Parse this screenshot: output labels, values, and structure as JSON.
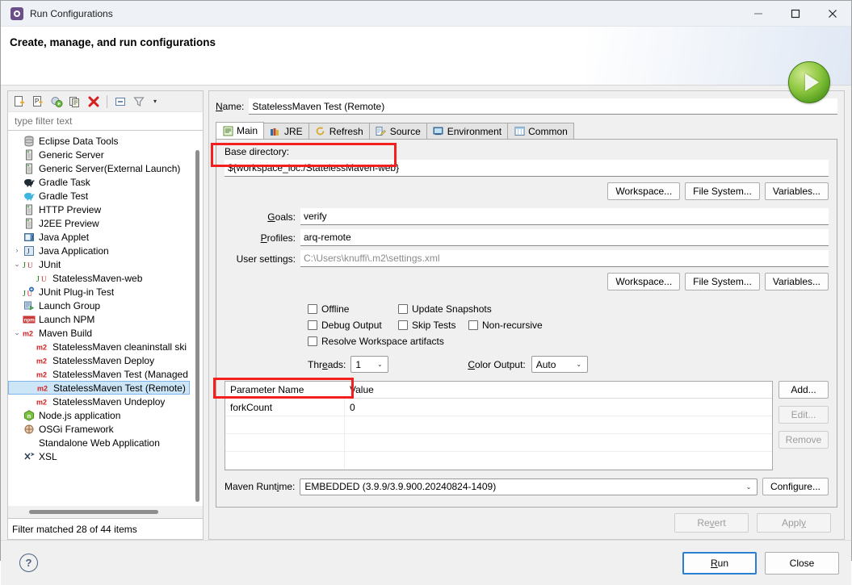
{
  "window": {
    "title": "Run Configurations",
    "app_icon": "eclipse-run-icon",
    "minimize": "–",
    "maximize": "□",
    "close": "✕"
  },
  "header": {
    "title": "Create, manage, and run configurations",
    "banner_icon": "green-run-globe-icon"
  },
  "tree_toolbar": {
    "buttons": [
      {
        "name": "new-configuration-icon",
        "tip": "New launch configuration"
      },
      {
        "name": "new-prototype-icon",
        "tip": "New prototype"
      },
      {
        "name": "export-icon",
        "tip": "Export"
      },
      {
        "name": "duplicate-icon",
        "tip": "Duplicate"
      },
      {
        "name": "delete-icon",
        "tip": "Delete"
      },
      {
        "name": "collapse-all-icon",
        "tip": "Collapse All"
      },
      {
        "name": "filter-icon",
        "tip": "Filter launch configurations"
      }
    ],
    "menu_caret": "▾"
  },
  "filter": {
    "placeholder": "type filter text",
    "value": "",
    "status": "Filter matched 28 of 44 items"
  },
  "tree": {
    "items": [
      {
        "label": "Eclipse Data Tools",
        "icon": "database-icon",
        "indent": 1,
        "twisty": "",
        "selected": false
      },
      {
        "label": "Generic Server",
        "icon": "server-icon",
        "indent": 1,
        "twisty": "",
        "selected": false
      },
      {
        "label": "Generic Server(External Launch)",
        "icon": "server-icon",
        "indent": 1,
        "twisty": "",
        "selected": false
      },
      {
        "label": "Gradle Task",
        "icon": "gradle-elephant-dark-icon",
        "indent": 1,
        "twisty": "",
        "selected": false
      },
      {
        "label": "Gradle Test",
        "icon": "gradle-elephant-blue-icon",
        "indent": 1,
        "twisty": "",
        "selected": false
      },
      {
        "label": "HTTP Preview",
        "icon": "server-icon",
        "indent": 1,
        "twisty": "",
        "selected": false
      },
      {
        "label": "J2EE Preview",
        "icon": "server-icon",
        "indent": 1,
        "twisty": "",
        "selected": false
      },
      {
        "label": "Java Applet",
        "icon": "java-applet-icon",
        "indent": 1,
        "twisty": "",
        "selected": false
      },
      {
        "label": "Java Application",
        "icon": "java-application-icon",
        "indent": 1,
        "twisty": "›",
        "selected": false
      },
      {
        "label": "JUnit",
        "icon": "junit-icon",
        "indent": 1,
        "twisty": "⌄",
        "selected": false
      },
      {
        "label": "StatelessMaven-web",
        "icon": "junit-icon",
        "indent": 2,
        "twisty": "",
        "selected": false
      },
      {
        "label": "JUnit Plug-in Test",
        "icon": "junit-plugin-icon",
        "indent": 1,
        "twisty": "",
        "selected": false
      },
      {
        "label": "Launch Group",
        "icon": "launch-group-icon",
        "indent": 1,
        "twisty": "",
        "selected": false
      },
      {
        "label": "Launch NPM",
        "icon": "npm-icon",
        "indent": 1,
        "twisty": "",
        "selected": false
      },
      {
        "label": "Maven Build",
        "icon": "maven-icon",
        "indent": 1,
        "twisty": "⌄",
        "selected": false
      },
      {
        "label": "StatelessMaven cleaninstall ski",
        "icon": "maven-icon",
        "indent": 2,
        "twisty": "",
        "selected": false
      },
      {
        "label": "StatelessMaven Deploy",
        "icon": "maven-icon",
        "indent": 2,
        "twisty": "",
        "selected": false
      },
      {
        "label": "StatelessMaven Test (Managed",
        "icon": "maven-icon",
        "indent": 2,
        "twisty": "",
        "selected": false
      },
      {
        "label": "StatelessMaven Test (Remote)",
        "icon": "maven-icon",
        "indent": 2,
        "twisty": "",
        "selected": true
      },
      {
        "label": "StatelessMaven Undeploy",
        "icon": "maven-icon",
        "indent": 2,
        "twisty": "",
        "selected": false
      },
      {
        "label": "Node.js application",
        "icon": "nodejs-icon",
        "indent": 1,
        "twisty": "",
        "selected": false
      },
      {
        "label": "OSGi Framework",
        "icon": "osgi-icon",
        "indent": 1,
        "twisty": "",
        "selected": false
      },
      {
        "label": "Standalone Web Application",
        "icon": "",
        "indent": 1,
        "twisty": "",
        "selected": false
      },
      {
        "label": "XSL",
        "icon": "xsl-icon",
        "indent": 1,
        "twisty": "",
        "selected": false
      }
    ]
  },
  "config": {
    "name_label": "Name:",
    "name_value": "StatelessMaven Test (Remote)",
    "tabs": [
      {
        "label": "Main",
        "icon": "main-tab-icon",
        "active": true
      },
      {
        "label": "JRE",
        "icon": "jre-tab-icon",
        "active": false
      },
      {
        "label": "Refresh",
        "icon": "refresh-tab-icon",
        "active": false
      },
      {
        "label": "Source",
        "icon": "source-tab-icon",
        "active": false
      },
      {
        "label": "Environment",
        "icon": "environment-tab-icon",
        "active": false
      },
      {
        "label": "Common",
        "icon": "common-tab-icon",
        "active": false
      }
    ],
    "base_directory_label": "Base directory:",
    "base_directory_value": "${workspace_loc:/StatelessMaven-web}",
    "dir_buttons": [
      "Workspace...",
      "File System...",
      "Variables..."
    ],
    "goals_label": "Goals:",
    "goals_value": "verify",
    "profiles_label": "Profiles:",
    "profiles_value": "arq-remote",
    "user_settings_label": "User settings:",
    "user_settings_value": "C:\\Users\\knuffi\\.m2\\settings.xml",
    "settings_buttons": [
      "Workspace...",
      "File System...",
      "Variables..."
    ],
    "checkboxes": [
      {
        "label": "Offline",
        "checked": false
      },
      {
        "label": "Update Snapshots",
        "checked": false
      },
      {
        "label": "Debug Output",
        "checked": false
      },
      {
        "label": "Skip Tests",
        "checked": false
      },
      {
        "label": "Non-recursive",
        "checked": false
      },
      {
        "label": "Resolve Workspace artifacts",
        "checked": false
      }
    ],
    "threads_label": "Threads:",
    "threads_value": "1",
    "color_output_label": "Color Output:",
    "color_output_value": "Auto",
    "table": {
      "columns": [
        "Parameter Name",
        "Value"
      ],
      "rows": [
        {
          "name": "forkCount",
          "value": "0"
        },
        {
          "name": "",
          "value": ""
        },
        {
          "name": "",
          "value": ""
        },
        {
          "name": "",
          "value": ""
        }
      ]
    },
    "table_buttons": [
      {
        "label": "Add...",
        "disabled": false
      },
      {
        "label": "Edit...",
        "disabled": true
      },
      {
        "label": "Remove",
        "disabled": true
      }
    ],
    "maven_runtime_label": "Maven Runtime:",
    "maven_runtime_value": "EMBEDDED (3.9.9/3.9.900.20240824-1409)",
    "configure_label": "Configure...",
    "revert_label": "Revert",
    "apply_label": "Apply"
  },
  "footer": {
    "help_icon": "help-question-icon",
    "run_label": "Run",
    "close_label": "Close"
  },
  "colors": {
    "accent": "#2b7fd1",
    "selection": "#cde6f7",
    "highlight_box": "#f41f1f",
    "maven_red": "#d02020",
    "junit_green": "#2e8b2e",
    "run_green": "#8cc63f"
  }
}
